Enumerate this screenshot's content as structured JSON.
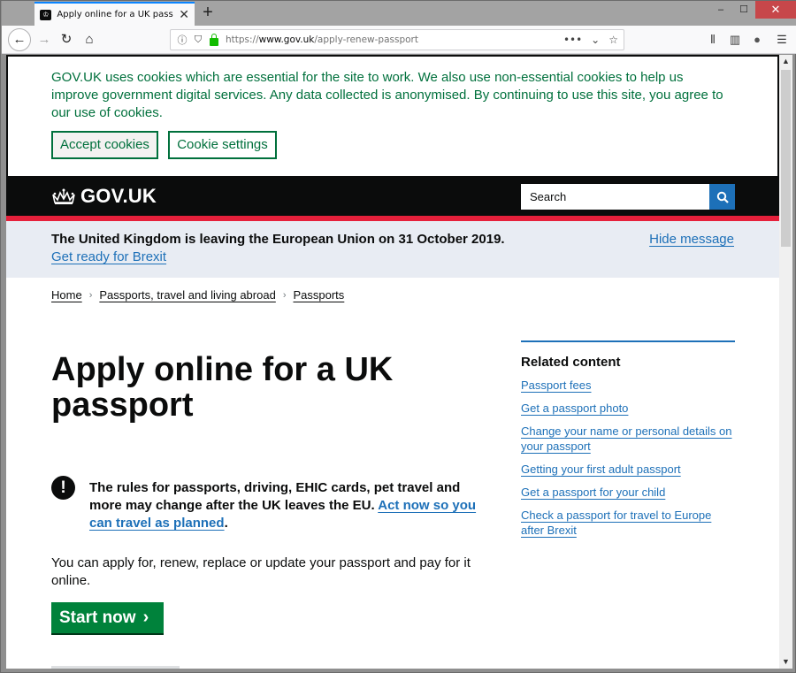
{
  "browser": {
    "tab_title": "Apply online for a UK passport",
    "new_tab_label": "+",
    "url_scheme": "https://",
    "url_host": "www.gov.uk",
    "url_path": "/apply-renew-passport",
    "window_controls": {
      "minimize": "–",
      "maximize": "☐",
      "close": "✕"
    },
    "icons": {
      "back": "←",
      "forward": "→",
      "reload": "↻",
      "home": "⌂",
      "info": "ⓘ",
      "shield": "⛉",
      "more": "•••",
      "pocket": "⌄",
      "star": "☆",
      "library": "⫴",
      "sidebar": "▥",
      "account": "●",
      "menu": "☰",
      "tab_close": "✕"
    }
  },
  "cookie_banner": {
    "text": "GOV.UK uses cookies which are essential for the site to work. We also use non-essential cookies to help us improve government digital services. Any data collected is anonymised. By continuing to use this site, you agree to our use of cookies.",
    "accept_label": "Accept cookies",
    "settings_label": "Cookie settings"
  },
  "header": {
    "logo_text": "GOV.UK",
    "search_placeholder": "Search"
  },
  "brexit_banner": {
    "message": "The United Kingdom is leaving the European Union on 31 October 2019.",
    "link": "Get ready for Brexit",
    "hide_label": "Hide message"
  },
  "breadcrumb": [
    {
      "label": "Home"
    },
    {
      "label": "Passports, travel and living abroad"
    },
    {
      "label": "Passports"
    }
  ],
  "breadcrumb_separator": "›",
  "main": {
    "title": "Apply online for a UK passport",
    "warning_icon": "!",
    "warning_text": "The rules for passports, driving, EHIC cards, pet travel and more may change after the UK leaves the EU.",
    "warning_link": "Act now so you can travel as planned",
    "warning_suffix": ".",
    "lead": "You can apply for, renew, replace or update your passport and pay for it online.",
    "start_label": "Start now",
    "start_chevron": "›"
  },
  "related": {
    "heading": "Related content",
    "links": [
      {
        "label": "Passport fees"
      },
      {
        "label": "Get a passport photo"
      },
      {
        "label": "Change your name or personal details on your passport"
      },
      {
        "label": "Getting your first adult passport"
      },
      {
        "label": "Get a passport for your child"
      },
      {
        "label": "Check a passport for travel to Europe after Brexit"
      }
    ]
  },
  "colors": {
    "govuk_black": "#0b0c0c",
    "link_blue": "#1d70b8",
    "cookie_green": "#00703c",
    "start_green": "#00823b",
    "header_red": "#e6203b",
    "brexit_bg": "#e8ecf3"
  }
}
